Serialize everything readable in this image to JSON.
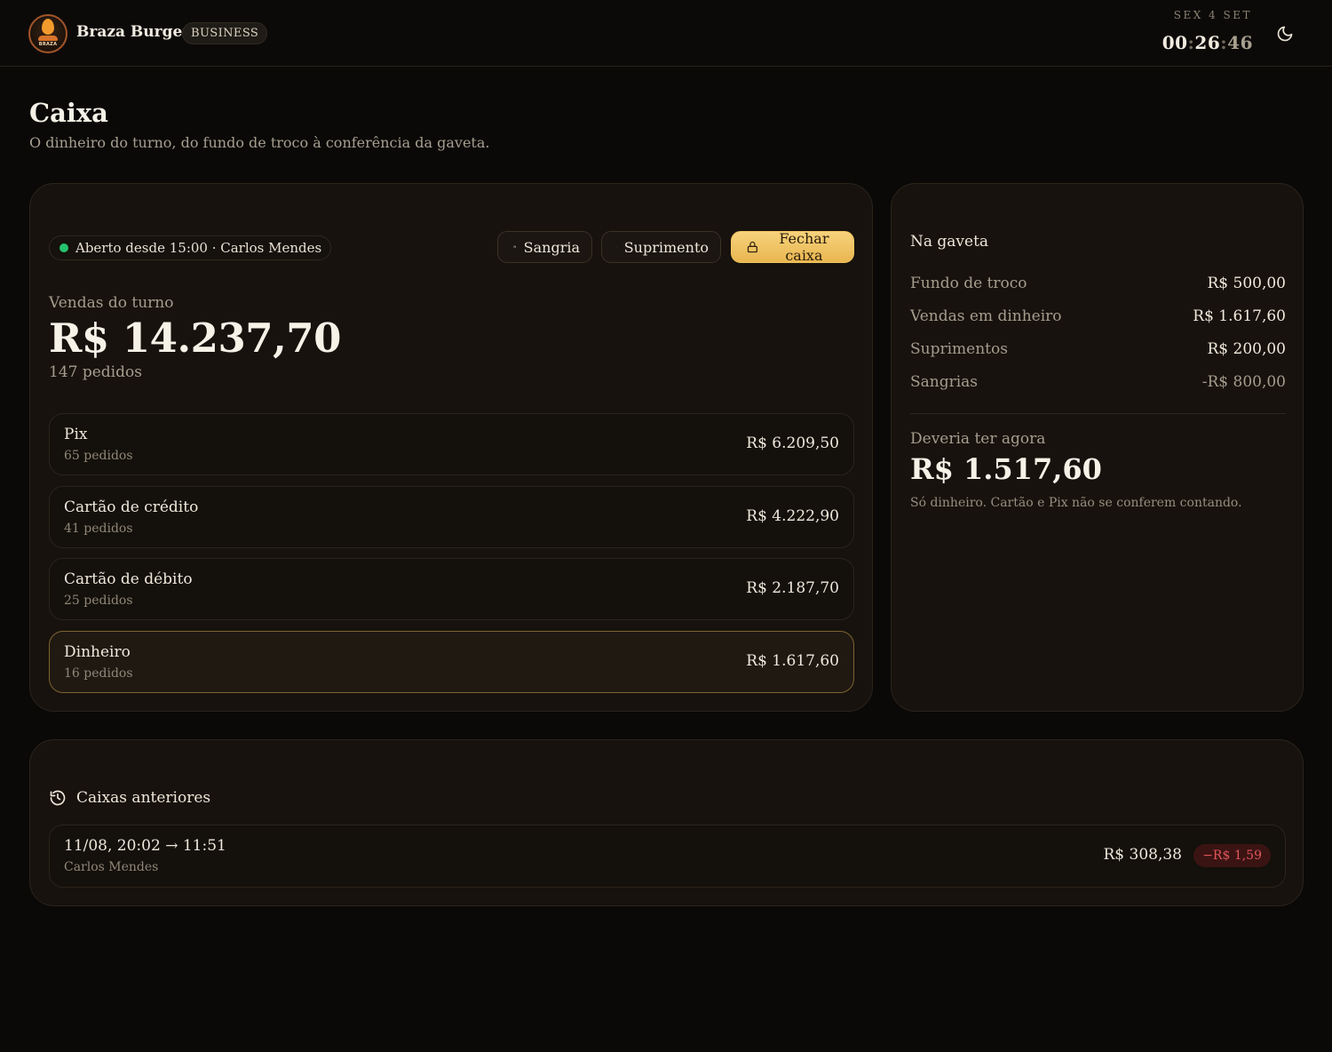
{
  "header": {
    "brand_name": "Braza Burger",
    "badge": "BUSINESS",
    "logo_text": "BRAZA",
    "day": "SEX 4 SET",
    "time_hours": "00",
    "time_minutes": "26",
    "time_seconds": "46",
    "theme_icon": "moon-icon"
  },
  "page": {
    "title": "Caixa",
    "subtitle": "O dinheiro do turno, do fundo de troco à conferência da gaveta."
  },
  "register": {
    "status": "Aberto desde 15:00 · Carlos Mendes",
    "status_color": "#25c26e",
    "actions": {
      "sangria": "Sangria",
      "suprimento": "Suprimento",
      "fechar": "Fechar caixa"
    },
    "sales_label": "Vendas do turno",
    "sales_total": "R$ 14.237,70",
    "orders_count": "147 pedidos",
    "payments": [
      {
        "name": "Pix",
        "count": "65 pedidos",
        "amount": "R$ 6.209,50"
      },
      {
        "name": "Cartão de crédito",
        "count": "41 pedidos",
        "amount": "R$ 4.222,90"
      },
      {
        "name": "Cartão de débito",
        "count": "25 pedidos",
        "amount": "R$ 2.187,70"
      },
      {
        "name": "Dinheiro",
        "count": "16 pedidos",
        "amount": "R$ 1.617,60"
      }
    ]
  },
  "drawer": {
    "title": "Na gaveta",
    "lines": [
      {
        "label": "Fundo de troco",
        "value": "R$ 500,00"
      },
      {
        "label": "Vendas em dinheiro",
        "value": "R$ 1.617,60"
      },
      {
        "label": "Suprimentos",
        "value": "R$ 200,00"
      },
      {
        "label": "Sangrias",
        "value": "-R$ 800,00"
      }
    ],
    "expected_label": "Deveria ter agora",
    "expected_value": "R$ 1.517,60",
    "note": "Só dinheiro. Cartão e Pix não se conferem contando."
  },
  "history": {
    "title": "Caixas anteriores",
    "items": [
      {
        "range": "11/08, 20:02 → 11:51",
        "operator": "Carlos Mendes",
        "amount": "R$ 308,38",
        "difference": "−R$ 1,59"
      }
    ]
  },
  "colors": {
    "accent": "#f0c560",
    "negative": "#e0555a",
    "positive": "#25c26e"
  }
}
